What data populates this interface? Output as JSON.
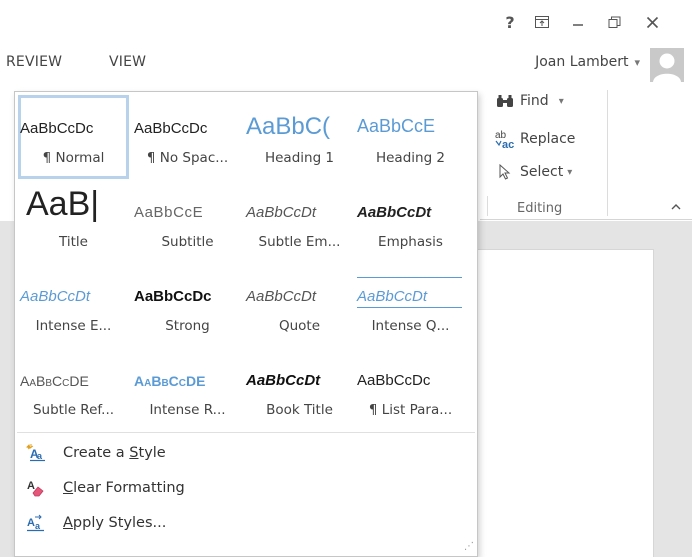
{
  "window": {
    "help_icon": "?",
    "ribbon_display_icon": "ribbon-display-options",
    "minimize_icon": "minimize",
    "restore_icon": "restore",
    "close_icon": "close"
  },
  "tabs": [
    {
      "label": "REVIEW"
    },
    {
      "label": "VIEW"
    }
  ],
  "user": {
    "name": "Joan Lambert",
    "dropdown_glyph": "▾"
  },
  "editing": {
    "find": "Find",
    "find_glyph": "▾",
    "replace": "Replace",
    "select": "Select",
    "select_glyph": "▾",
    "group_label": "Editing",
    "collapse_glyph": "^"
  },
  "styles": [
    {
      "sample": "AaBbCcDc",
      "label": "¶ Normal",
      "selected": true
    },
    {
      "sample": "AaBbCcDc",
      "label": "¶ No Spac..."
    },
    {
      "sample": "AaBbC(",
      "label": "Heading 1"
    },
    {
      "sample": "AaBbCcE",
      "label": "Heading 2"
    },
    {
      "sample": "AaB|",
      "label": "Title"
    },
    {
      "sample": "AaBbCcE",
      "label": "Subtitle"
    },
    {
      "sample": "AaBbCcDt",
      "label": "Subtle Em..."
    },
    {
      "sample": "AaBbCcDt",
      "label": "Emphasis"
    },
    {
      "sample": "AaBbCcDt",
      "label": "Intense E..."
    },
    {
      "sample": "AaBbCcDc",
      "label": "Strong"
    },
    {
      "sample": "AaBbCcDt",
      "label": "Quote"
    },
    {
      "sample": "AaBbCcDt",
      "label": "Intense Q..."
    },
    {
      "sample": "AaBbCcDE",
      "label": "Subtle Ref..."
    },
    {
      "sample": "AaBbCcDE",
      "label": "Intense R..."
    },
    {
      "sample": "AaBbCcDt",
      "label": "Book Title"
    },
    {
      "sample": "AaBbCcDc",
      "label": "¶ List Para..."
    }
  ],
  "menu": {
    "create_style": {
      "pre": "Create a ",
      "key": "S",
      "post": "tyle"
    },
    "clear_formatting": {
      "pre": "",
      "key": "C",
      "post": "lear Formatting"
    },
    "apply_styles": {
      "pre": "",
      "key": "A",
      "post": "pply Styles..."
    }
  },
  "colors": {
    "accent_blue": "#5b9bd5",
    "selection_outline": "#b9d2eb",
    "background_gray": "#e4e4e4"
  }
}
